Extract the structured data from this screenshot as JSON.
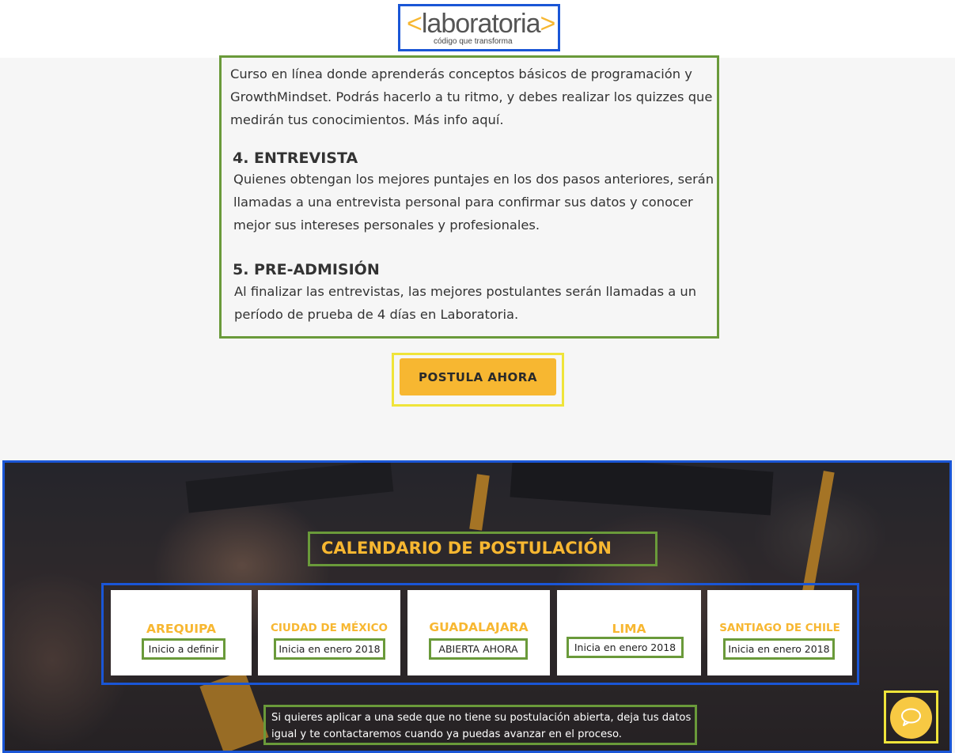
{
  "header": {
    "logo_open": "<",
    "logo_word": "laboratoria",
    "logo_close": ">",
    "logo_tagline": "código que transforma"
  },
  "content": {
    "intro": "Curso en línea donde aprenderás conceptos básicos de programación y GrowthMindset. Podrás hacerlo a tu ritmo, y debes realizar los quizzes que medirán tus conocimientos. Más info aquí.",
    "step4_title": "4. ENTREVISTA",
    "step4_text": "Quienes obtengan los mejores puntajes en los dos pasos anteriores, serán llamadas a una entrevista personal para confirmar sus datos y conocer mejor sus intereses personales y profesionales.",
    "step5_title": "5. PRE-ADMISIÓN",
    "step5_text": "Al finalizar las entrevistas, las mejores postulantes serán llamadas a un período de prueba de 4 días en Laboratoria."
  },
  "cta": {
    "label": "POSTULA AHORA"
  },
  "calendar": {
    "title": "CALENDARIO DE POSTULACIÓN",
    "cards": [
      {
        "city": "AREQUIPA",
        "status": "Inicio a definir"
      },
      {
        "city": "CIUDAD DE MÉXICO",
        "status": "Inicia en enero 2018"
      },
      {
        "city": "GUADALAJARA",
        "status": "ABIERTA AHORA"
      },
      {
        "city": "LIMA",
        "status": "Inicia en enero 2018"
      },
      {
        "city": "SANTIAGO DE CHILE",
        "status": "Inicia en enero 2018"
      }
    ],
    "note": "Si quieres aplicar a una sede que no tiene su postulación abierta, deja tus datos igual y te contactaremos cuando  ya puedas avanzar en el proceso."
  },
  "chat": {
    "icon": "chat-bubble-icon"
  },
  "colors": {
    "accent": "#f7b731",
    "green_outline": "#6a9a3a",
    "blue_outline": "#1a56d6",
    "yellow_outline": "#efe43a"
  }
}
